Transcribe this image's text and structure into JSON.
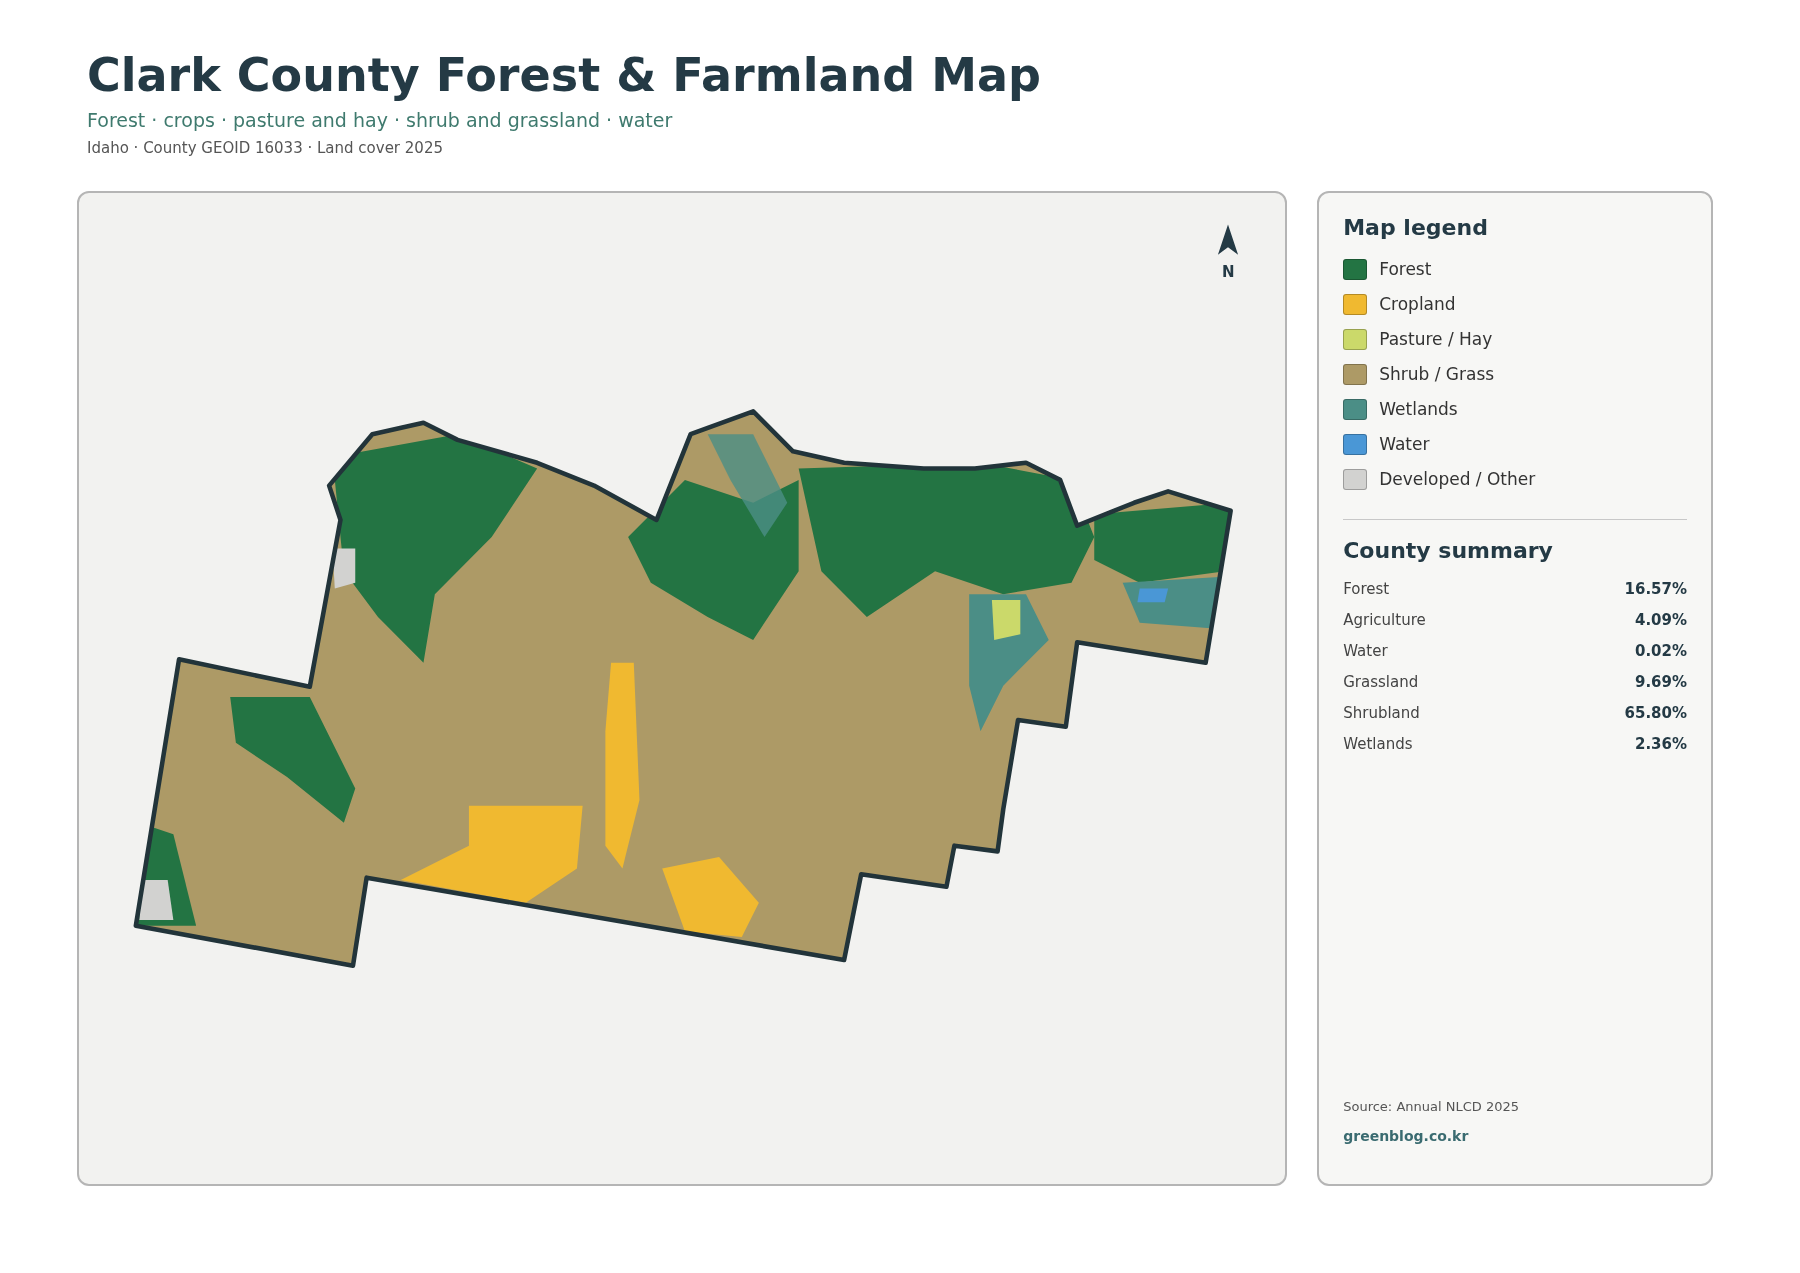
{
  "header": {
    "title": "Clark County Forest & Farmland Map",
    "subtitle": "Forest · crops · pasture and hay · shrub and grassland · water",
    "meta": "Idaho · County GEOID 16033 · Land cover 2025"
  },
  "map": {
    "north_label": "N"
  },
  "legend": {
    "title": "Map legend",
    "items": [
      {
        "label": "Forest",
        "color": "#237443"
      },
      {
        "label": "Cropland",
        "color": "#f0b930"
      },
      {
        "label": "Pasture / Hay",
        "color": "#cbd96a"
      },
      {
        "label": "Shrub / Grass",
        "color": "#ad9a66"
      },
      {
        "label": "Wetlands",
        "color": "#4b8e86"
      },
      {
        "label": "Water",
        "color": "#4a97d6"
      },
      {
        "label": "Developed / Other",
        "color": "#d2d2d0"
      }
    ]
  },
  "summary": {
    "title": "County summary",
    "rows": [
      {
        "label": "Forest",
        "value": "16.57%"
      },
      {
        "label": "Agriculture",
        "value": "4.09%"
      },
      {
        "label": "Water",
        "value": "0.02%"
      },
      {
        "label": "Grassland",
        "value": "9.69%"
      },
      {
        "label": "Shrubland",
        "value": "65.80%"
      },
      {
        "label": "Wetlands",
        "value": "2.36%"
      }
    ]
  },
  "footer": {
    "source": "Source: Annual NLCD 2025",
    "link": "greenblog.co.kr"
  }
}
